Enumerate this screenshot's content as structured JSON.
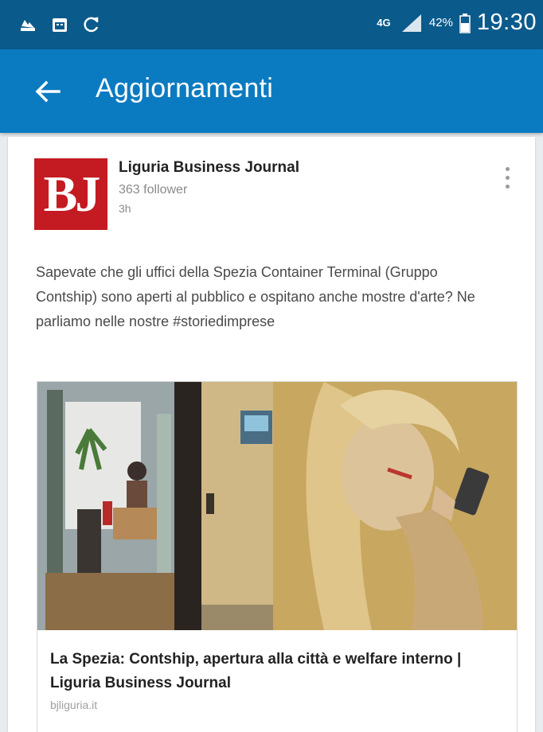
{
  "statusbar": {
    "network": "4G",
    "battery": "42%",
    "time": "19:30"
  },
  "appbar": {
    "title": "Aggiornamenti"
  },
  "post": {
    "logo_text": "BJ",
    "author_name": "Liguria Business Journal",
    "followers": "363 follower",
    "time_ago": "3h",
    "text": "Sapevate che gli uffici della Spezia Container Terminal (Gruppo Contship) sono aperti al pubblico e ospitano anche mostre d'arte? Ne parliamo nelle nostre #storiedimprese",
    "article": {
      "title": "La Spezia: Contship, apertura alla città e welfare interno | Liguria Business Journal",
      "source": "bjliguria.it"
    }
  },
  "colors": {
    "statusbar": "#0a5a8c",
    "appbar": "#0b7bc1",
    "logo": "#c41a22"
  }
}
